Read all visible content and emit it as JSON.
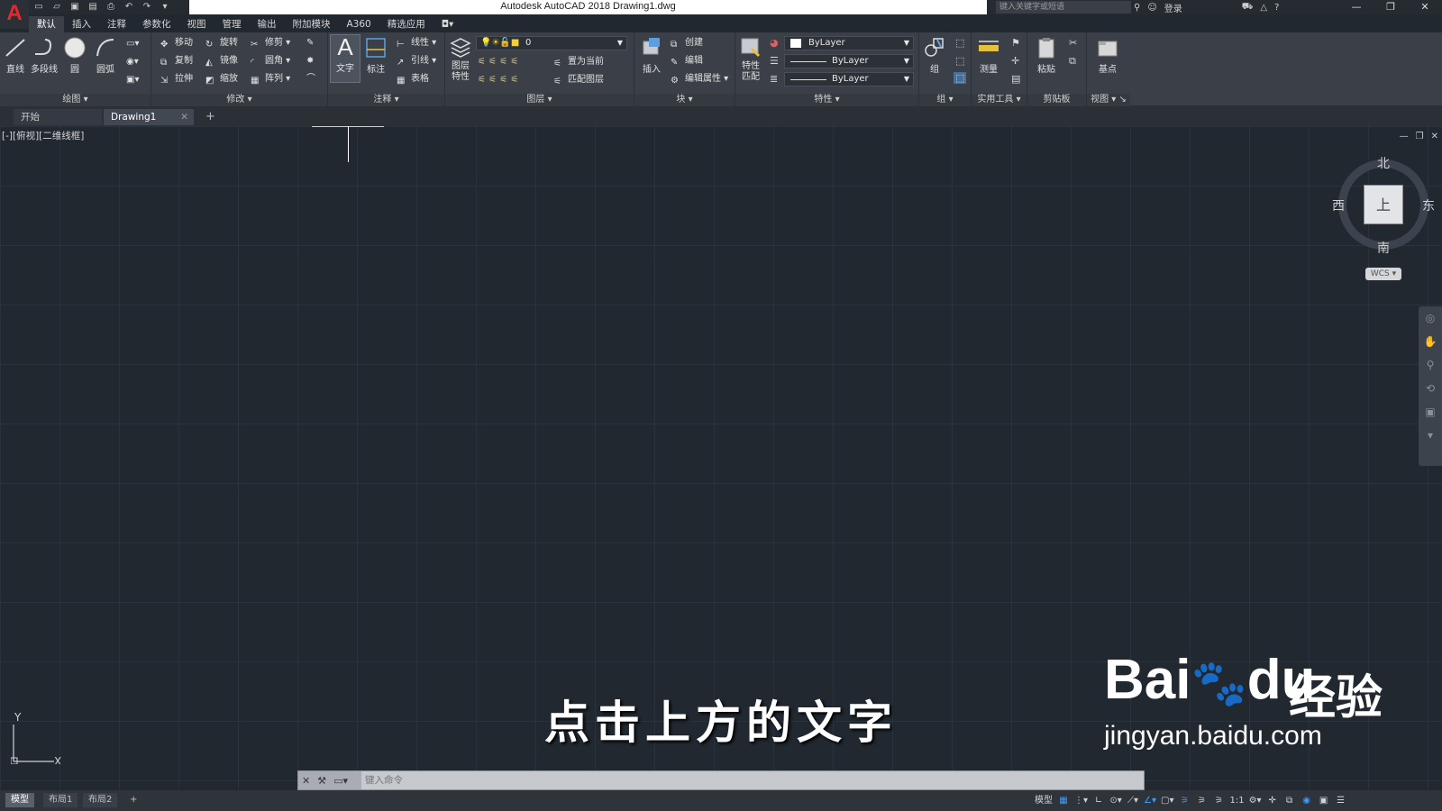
{
  "app": {
    "logo": "A",
    "window_title": "Autodesk AutoCAD 2018    Drawing1.dwg",
    "search_placeholder": "键入关键字或短语",
    "login": "登录",
    "win_controls": [
      "—",
      "❐",
      "✕"
    ]
  },
  "menu": {
    "tabs": [
      "默认",
      "插入",
      "注释",
      "参数化",
      "视图",
      "管理",
      "输出",
      "附加模块",
      "A360",
      "精选应用"
    ],
    "active_index": 0
  },
  "ribbon": {
    "draw": {
      "title": "绘图",
      "line": "直线",
      "polyline": "多段线",
      "circle": "圆",
      "arc": "圆弧"
    },
    "modify": {
      "title": "修改",
      "move": "移动",
      "rotate": "旋转",
      "trim": "修剪",
      "copy": "复制",
      "mirror": "镜像",
      "fillet": "圆角",
      "stretch": "拉伸",
      "scale": "缩放",
      "array": "阵列"
    },
    "annotation": {
      "title": "注释",
      "text": "文字",
      "dimension": "标注",
      "linear": "线性",
      "leader": "引线",
      "table": "表格"
    },
    "layers": {
      "title": "图层",
      "properties": "图层\n特性",
      "layer_value": "0",
      "set_current": "置为当前",
      "match_layer": "匹配图层"
    },
    "block": {
      "title": "块",
      "insert": "插入",
      "create": "创建",
      "edit": "编辑",
      "edit_attr": "编辑属性"
    },
    "properties": {
      "title": "特性",
      "match": "特性\n匹配",
      "color": "ByLayer",
      "linetype": "ByLayer",
      "lineweight": "ByLayer"
    },
    "groups": {
      "title": "组",
      "group": "组"
    },
    "utilities": {
      "title": "实用工具",
      "measure": "测量"
    },
    "clipboard": {
      "title": "剪贴板",
      "paste": "粘贴"
    },
    "view": {
      "title": "视图",
      "base": "基点"
    }
  },
  "doc_tabs": {
    "start": "开始",
    "drawing": "Drawing1",
    "add": "+"
  },
  "canvas": {
    "view_label": "[-][俯视][二维线框]",
    "viewcube": {
      "north": "北",
      "south": "南",
      "east": "东",
      "west": "西",
      "face": "上"
    },
    "wcs": "WCS",
    "ucs_x": "X",
    "ucs_y": "Y"
  },
  "overlay": {
    "subtitle": "点击上方的文字",
    "watermark_brand": "Bai",
    "watermark_brand2": "du",
    "watermark_cn": "经验",
    "watermark_site": "jingyan.baidu.com"
  },
  "command": {
    "placeholder": "键入命令"
  },
  "status": {
    "layouts": [
      "模型",
      "布局1",
      "布局2",
      "+"
    ],
    "active_layout": 0,
    "scale": "1:1"
  }
}
